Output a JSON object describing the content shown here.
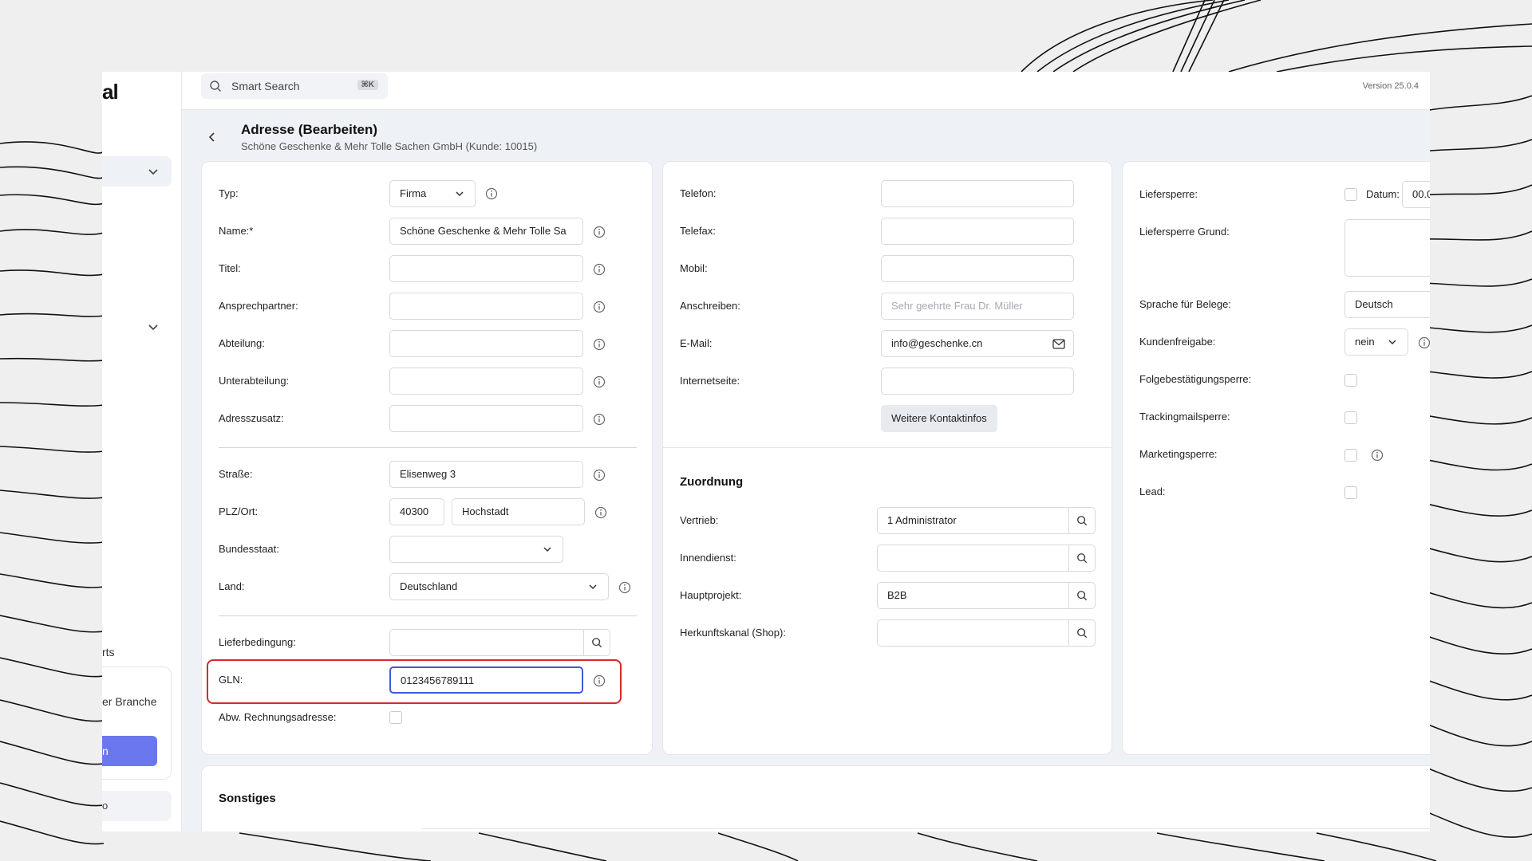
{
  "sidebar": {
    "logo": "al",
    "partial_text_1": "rts",
    "partial_text_2": "er Branche",
    "partial_button": "n",
    "partial_grey": "o"
  },
  "topbar": {
    "search_placeholder": "Smart Search",
    "search_shortcut": "⌘K",
    "version": "Version 25.0.4"
  },
  "header": {
    "title": "Adresse (Bearbeiten)",
    "subtitle": "Schöne Geschenke & Mehr Tolle Sachen GmbH (Kunde: 10015)"
  },
  "left_panel": {
    "typ_label": "Typ:",
    "typ_value": "Firma",
    "name_label": "Name:*",
    "name_value": "Schöne Geschenke & Mehr Tolle Sa",
    "titel_label": "Titel:",
    "ansprechpartner_label": "Ansprechpartner:",
    "abteilung_label": "Abteilung:",
    "unterabteilung_label": "Unterabteilung:",
    "adresszusatz_label": "Adresszusatz:",
    "strasse_label": "Straße:",
    "strasse_value": "Elisenweg 3",
    "plzort_label": "PLZ/Ort:",
    "plz_value": "40300",
    "ort_value": "Hochstadt",
    "bundesstaat_label": "Bundesstaat:",
    "bundesstaat_value": "",
    "land_label": "Land:",
    "land_value": "Deutschland",
    "lieferbedingung_label": "Lieferbedingung:",
    "gln_label": "GLN:",
    "gln_value": "0123456789111",
    "abw_label": "Abw. Rechnungsadresse:"
  },
  "middle_panel": {
    "telefon_label": "Telefon:",
    "telefax_label": "Telefax:",
    "mobil_label": "Mobil:",
    "anschreiben_label": "Anschreiben:",
    "anschreiben_placeholder": "Sehr geehrte Frau Dr. Müller",
    "email_label": "E-Mail:",
    "email_value": "info@geschenke.cn",
    "internet_label": "Internetseite:",
    "kontakt_button": "Weitere Kontaktinfos",
    "zuordnung_title": "Zuordnung",
    "vertrieb_label": "Vertrieb:",
    "vertrieb_value": "1 Administrator",
    "innendienst_label": "Innendienst:",
    "hauptprojekt_label": "Hauptprojekt:",
    "hauptprojekt_value": "B2B",
    "herkunft_label": "Herkunftskanal (Shop):"
  },
  "right_panel": {
    "liefersperre_label": "Liefersperre:",
    "datum_label": "Datum:",
    "datum_value": "00.0",
    "liefersperre_grund_label": "Liefersperre Grund:",
    "sprache_label": "Sprache für Belege:",
    "sprache_value": "Deutsch",
    "kundenfreigabe_label": "Kundenfreigabe:",
    "kundenfreigabe_value": "nein",
    "folge_label": "Folgebestätigungsperre:",
    "tracking_label": "Trackingmailsperre:",
    "marketing_label": "Marketingsperre:",
    "lead_label": "Lead:"
  },
  "sonstiges": {
    "title": "Sonstiges"
  },
  "colors": {
    "accent": "#6b77ee",
    "highlight": "#d42a2a",
    "focus": "#3b5bdb"
  }
}
